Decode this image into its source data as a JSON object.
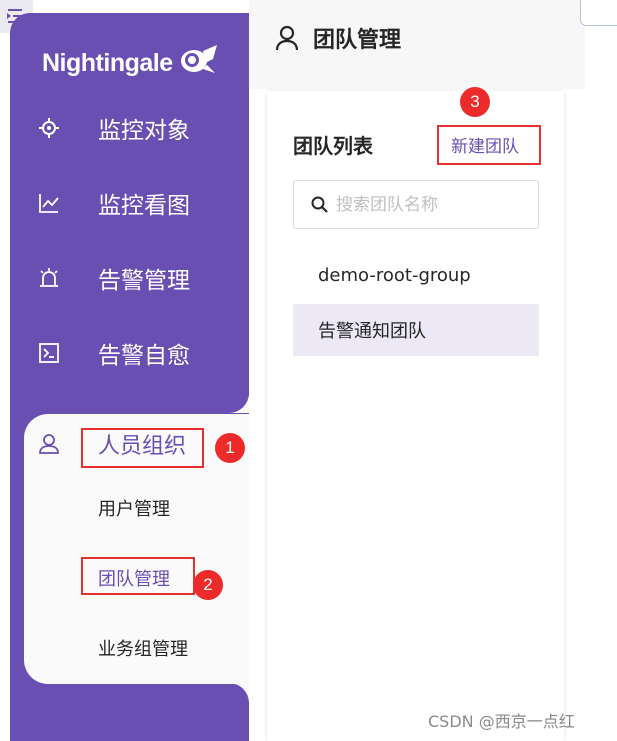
{
  "app": {
    "logo_text": "Nightingale"
  },
  "sidebar": {
    "items": [
      {
        "label": "监控对象",
        "icon": "target-icon"
      },
      {
        "label": "监控看图",
        "icon": "line-chart-icon"
      },
      {
        "label": "告警管理",
        "icon": "alarm-icon"
      },
      {
        "label": "告警自愈",
        "icon": "terminal-icon"
      }
    ],
    "group": {
      "label": "人员组织",
      "icon": "user-icon",
      "children": [
        "用户管理",
        "团队管理",
        "业务组管理"
      ],
      "active_child": "团队管理"
    }
  },
  "header": {
    "title": "团队管理",
    "icon": "user-icon"
  },
  "team_panel": {
    "title": "团队列表",
    "create_label": "新建团队",
    "search_placeholder": "搜索团队名称",
    "teams": [
      "demo-root-group",
      "告警通知团队"
    ],
    "selected_team": "告警通知团队"
  },
  "annotations": {
    "badges": [
      "1",
      "2",
      "3"
    ]
  },
  "watermark": "CSDN @西京一点红",
  "colors": {
    "brand": "#6a4fb3",
    "highlight": "#e8312f",
    "selected_row": "#ece8f5"
  }
}
